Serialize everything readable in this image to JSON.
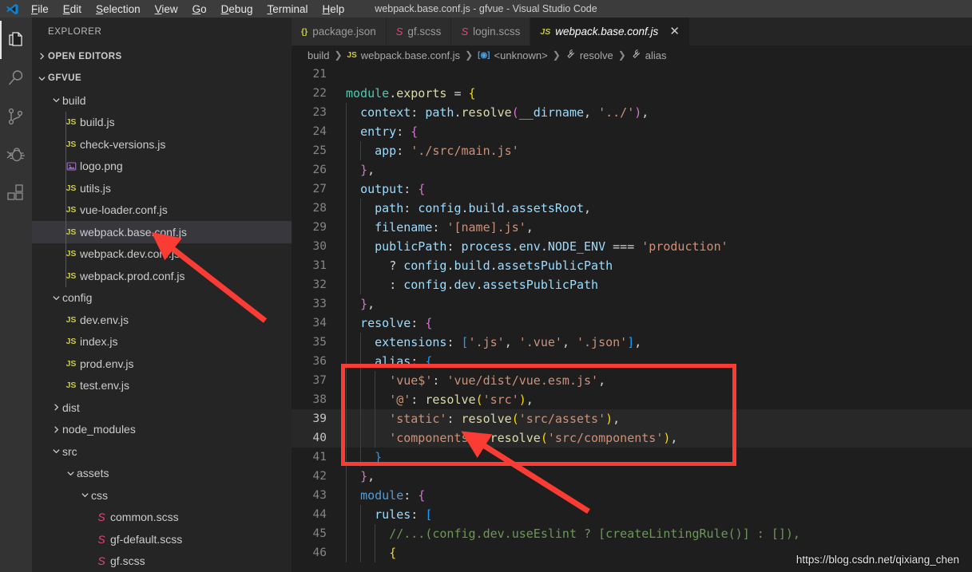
{
  "window": {
    "title": "webpack.base.conf.js - gfvue - Visual Studio Code",
    "logo_icon": "vscode-logo-icon"
  },
  "menubar": {
    "items": [
      {
        "label": "File",
        "mnemonic": "F"
      },
      {
        "label": "Edit",
        "mnemonic": "E"
      },
      {
        "label": "Selection",
        "mnemonic": "S"
      },
      {
        "label": "View",
        "mnemonic": "V"
      },
      {
        "label": "Go",
        "mnemonic": "G"
      },
      {
        "label": "Debug",
        "mnemonic": "D"
      },
      {
        "label": "Terminal",
        "mnemonic": "T"
      },
      {
        "label": "Help",
        "mnemonic": "H"
      }
    ]
  },
  "activitybar": {
    "items": [
      {
        "name": "explorer-icon",
        "label": "Explorer",
        "active": true
      },
      {
        "name": "search-icon",
        "label": "Search",
        "active": false
      },
      {
        "name": "source-control-icon",
        "label": "Source Control",
        "active": false
      },
      {
        "name": "debug-icon",
        "label": "Run and Debug",
        "active": false
      },
      {
        "name": "extensions-icon",
        "label": "Extensions",
        "active": false
      }
    ]
  },
  "sidebar": {
    "title": "EXPLORER",
    "sections": [
      {
        "label": "OPEN EDITORS",
        "expanded": false
      },
      {
        "label": "GFVUE",
        "expanded": true
      }
    ],
    "tree": [
      {
        "label": "build",
        "depth": 1,
        "type": "folder",
        "expanded": true,
        "icon": "chevron-down-icon"
      },
      {
        "label": "build.js",
        "depth": 2,
        "type": "file",
        "icon": "js-file-icon"
      },
      {
        "label": "check-versions.js",
        "depth": 2,
        "type": "file",
        "icon": "js-file-icon"
      },
      {
        "label": "logo.png",
        "depth": 2,
        "type": "file",
        "icon": "image-file-icon"
      },
      {
        "label": "utils.js",
        "depth": 2,
        "type": "file",
        "icon": "js-file-icon"
      },
      {
        "label": "vue-loader.conf.js",
        "depth": 2,
        "type": "file",
        "icon": "js-file-icon"
      },
      {
        "label": "webpack.base.conf.js",
        "depth": 2,
        "type": "file",
        "icon": "js-file-icon",
        "selected": true
      },
      {
        "label": "webpack.dev.conf.js",
        "depth": 2,
        "type": "file",
        "icon": "js-file-icon"
      },
      {
        "label": "webpack.prod.conf.js",
        "depth": 2,
        "type": "file",
        "icon": "js-file-icon"
      },
      {
        "label": "config",
        "depth": 1,
        "type": "folder",
        "expanded": true,
        "icon": "chevron-down-icon"
      },
      {
        "label": "dev.env.js",
        "depth": 2,
        "type": "file",
        "icon": "js-file-icon"
      },
      {
        "label": "index.js",
        "depth": 2,
        "type": "file",
        "icon": "js-file-icon"
      },
      {
        "label": "prod.env.js",
        "depth": 2,
        "type": "file",
        "icon": "js-file-icon"
      },
      {
        "label": "test.env.js",
        "depth": 2,
        "type": "file",
        "icon": "js-file-icon"
      },
      {
        "label": "dist",
        "depth": 1,
        "type": "folder",
        "expanded": false,
        "icon": "chevron-right-icon"
      },
      {
        "label": "node_modules",
        "depth": 1,
        "type": "folder",
        "expanded": false,
        "icon": "chevron-right-icon"
      },
      {
        "label": "src",
        "depth": 1,
        "type": "folder",
        "expanded": true,
        "icon": "chevron-down-icon"
      },
      {
        "label": "assets",
        "depth": 2,
        "type": "folder",
        "expanded": true,
        "icon": "chevron-down-icon"
      },
      {
        "label": "css",
        "depth": 3,
        "type": "folder",
        "expanded": true,
        "icon": "chevron-down-icon"
      },
      {
        "label": "common.scss",
        "depth": 4,
        "type": "file",
        "icon": "scss-file-icon"
      },
      {
        "label": "gf-default.scss",
        "depth": 4,
        "type": "file",
        "icon": "scss-file-icon"
      },
      {
        "label": "gf.scss",
        "depth": 4,
        "type": "file",
        "icon": "scss-file-icon"
      }
    ]
  },
  "editor": {
    "tabs": [
      {
        "label": "package.json",
        "icon": "json-file-icon",
        "icon_text": "{}",
        "active": false,
        "closable": false
      },
      {
        "label": "gf.scss",
        "icon": "scss-file-icon",
        "icon_text": "S",
        "active": false,
        "closable": false
      },
      {
        "label": "login.scss",
        "icon": "scss-file-icon",
        "icon_text": "S",
        "active": false,
        "closable": false
      },
      {
        "label": "webpack.base.conf.js",
        "icon": "js-file-icon",
        "icon_text": "JS",
        "active": true,
        "closable": true
      }
    ],
    "close_glyph": "✕",
    "breadcrumbs": [
      {
        "label": "build",
        "icon": ""
      },
      {
        "label": "webpack.base.conf.js",
        "icon": "js-file-icon",
        "icon_text": "JS"
      },
      {
        "label": "<unknown>",
        "icon": "module-icon",
        "icon_text": "[◉]"
      },
      {
        "label": "resolve",
        "icon": "property-icon",
        "icon_text": "ᶞ"
      },
      {
        "label": "alias",
        "icon": "property-icon",
        "icon_text": "ᶞ"
      }
    ],
    "breadcrumb_separator": "❯",
    "first_line_number": 21,
    "lines": [
      {
        "n": 21,
        "text": "",
        "indent": 0
      },
      {
        "n": 22,
        "text": "module.exports = {",
        "indent": 0
      },
      {
        "n": 23,
        "text": "  context: path.resolve(__dirname, '../'),",
        "indent": 1
      },
      {
        "n": 24,
        "text": "  entry: {",
        "indent": 1
      },
      {
        "n": 25,
        "text": "    app: './src/main.js'",
        "indent": 2
      },
      {
        "n": 26,
        "text": "  },",
        "indent": 1
      },
      {
        "n": 27,
        "text": "  output: {",
        "indent": 1
      },
      {
        "n": 28,
        "text": "    path: config.build.assetsRoot,",
        "indent": 2
      },
      {
        "n": 29,
        "text": "    filename: '[name].js',",
        "indent": 2
      },
      {
        "n": 30,
        "text": "    publicPath: process.env.NODE_ENV === 'production'",
        "indent": 2
      },
      {
        "n": 31,
        "text": "      ? config.build.assetsPublicPath",
        "indent": 2
      },
      {
        "n": 32,
        "text": "      : config.dev.assetsPublicPath",
        "indent": 2
      },
      {
        "n": 33,
        "text": "  },",
        "indent": 1
      },
      {
        "n": 34,
        "text": "  resolve: {",
        "indent": 1
      },
      {
        "n": 35,
        "text": "    extensions: ['.js', '.vue', '.json'],",
        "indent": 2
      },
      {
        "n": 36,
        "text": "    alias: {",
        "indent": 2
      },
      {
        "n": 37,
        "text": "      'vue$': 'vue/dist/vue.esm.js',",
        "indent": 3
      },
      {
        "n": 38,
        "text": "      '@': resolve('src'),",
        "indent": 3
      },
      {
        "n": 39,
        "text": "      'static': resolve('src/assets'),",
        "indent": 3,
        "current": true
      },
      {
        "n": 40,
        "text": "      'components': resolve('src/components'),",
        "indent": 3,
        "current": true
      },
      {
        "n": 41,
        "text": "    }",
        "indent": 2
      },
      {
        "n": 42,
        "text": "  },",
        "indent": 1
      },
      {
        "n": 43,
        "text": "  module: {",
        "indent": 1
      },
      {
        "n": 44,
        "text": "    rules: [",
        "indent": 2
      },
      {
        "n": 45,
        "text": "      //...(config.dev.useEslint ? [createLintingRule()] : []),",
        "indent": 3
      },
      {
        "n": 46,
        "text": "      {",
        "indent": 3
      }
    ]
  },
  "annotations": {
    "highlight_box": {
      "name": "alias-highlight-box",
      "color": "#fa3c34"
    },
    "arrows": [
      {
        "name": "arrow-to-webpack-base-conf-file",
        "color": "#fa3c34"
      },
      {
        "name": "arrow-to-alias-static-line",
        "color": "#fa3c34"
      }
    ],
    "watermark": "https://blog.csdn.net/qixiang_chen"
  },
  "colors": {
    "editor_background": "#1e1e1e",
    "sidebar_background": "#252526",
    "activitybar_background": "#333333",
    "titlebar_background": "#3c3c3c",
    "accent_red": "#fa3c34",
    "selection": "#37373d"
  }
}
